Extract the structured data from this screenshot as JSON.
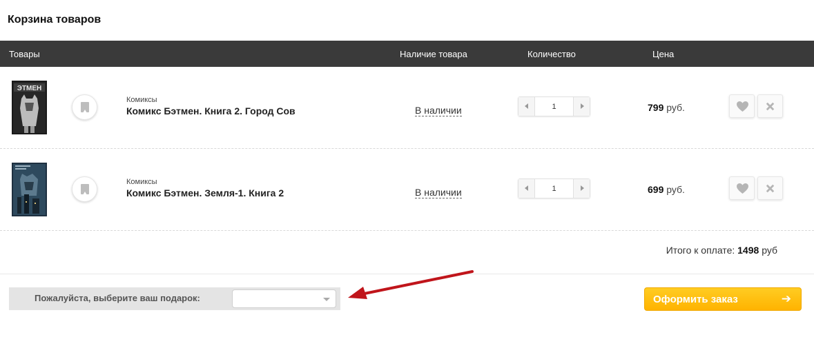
{
  "page": {
    "title": "Корзина товаров"
  },
  "table_header": {
    "goods": "Товары",
    "availability": "Наличие товара",
    "quantity": "Количество",
    "price": "Цена"
  },
  "items": [
    {
      "category": "Комиксы",
      "name": "Комикс Бэтмен. Книга 2. Город Сов",
      "availability": "В наличии",
      "quantity": "1",
      "price": "799",
      "currency": "руб.",
      "cover_text": "ЭТМЕН"
    },
    {
      "category": "Комиксы",
      "name": "Комикс Бэтмен. Земля-1. Книга 2",
      "availability": "В наличии",
      "quantity": "1",
      "price": "699",
      "currency": "руб."
    }
  ],
  "summary": {
    "label": "Итого к оплате:",
    "amount": "1498",
    "currency": "руб"
  },
  "gift": {
    "label": "Пожалуйста, выберите ваш подарок:",
    "selected": ""
  },
  "checkout": {
    "label": "Оформить заказ",
    "arrow": "➔"
  },
  "colors": {
    "header_bg": "#3a3a3a",
    "checkout_bg": "#ffbb11",
    "annotation_arrow": "#c0151b"
  }
}
